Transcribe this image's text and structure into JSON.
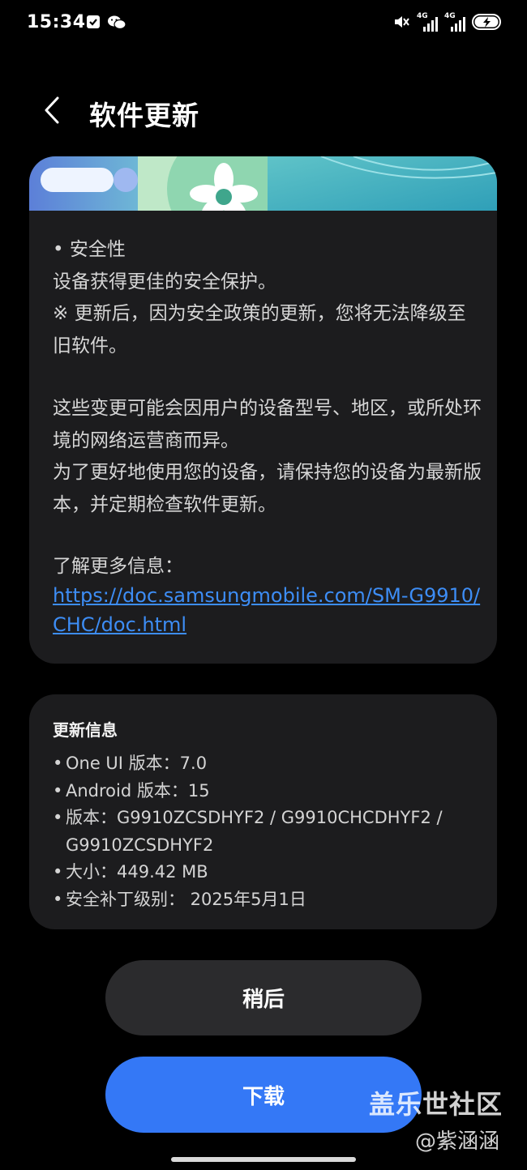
{
  "status_bar": {
    "time": "15:34",
    "network_1": "4G",
    "network_2": "4G",
    "icons": [
      "checkbox-notification-icon",
      "wechat-icon",
      "mute-icon",
      "signal-icon",
      "battery-charging-icon"
    ]
  },
  "header": {
    "title": "软件更新",
    "back_icon": "chevron-left-icon"
  },
  "release_notes": {
    "lines": [
      "• 安全性",
      "设备获得更佳的安全保护。",
      "※ 更新后，因为安全政策的更新，您将无法降级至旧软件。"
    ],
    "paragraph_2": [
      "这些变更可能会因用户的设备型号、地区，或所处环境的网络运营商而异。",
      "为了更好地使用您的设备，请保持您的设备为最新版本，并定期检查软件更新。"
    ],
    "more_info_label": "了解更多信息：",
    "more_info_link": "https://doc.samsungmobile.com/SM-G9910/CHC/doc.html"
  },
  "update_info": {
    "title": "更新信息",
    "items": [
      "One UI 版本：7.0",
      "Android 版本：15",
      "版本：G9910ZCSDHYF2 / G9910CHCDHYF2 / G9910ZCSDHYF2",
      "大小：449.42 MB",
      "安全补丁级别： 2025年5月1日"
    ]
  },
  "buttons": {
    "later": "稍后",
    "download": "下载"
  },
  "watermark": {
    "site": "盖乐世社区",
    "author": "@紫涵涵"
  },
  "colors": {
    "background": "#000000",
    "card": "#1c1c1e",
    "link": "#3d8df5",
    "primary_button": "#3478f6",
    "secondary_button": "#2b2b2d"
  }
}
